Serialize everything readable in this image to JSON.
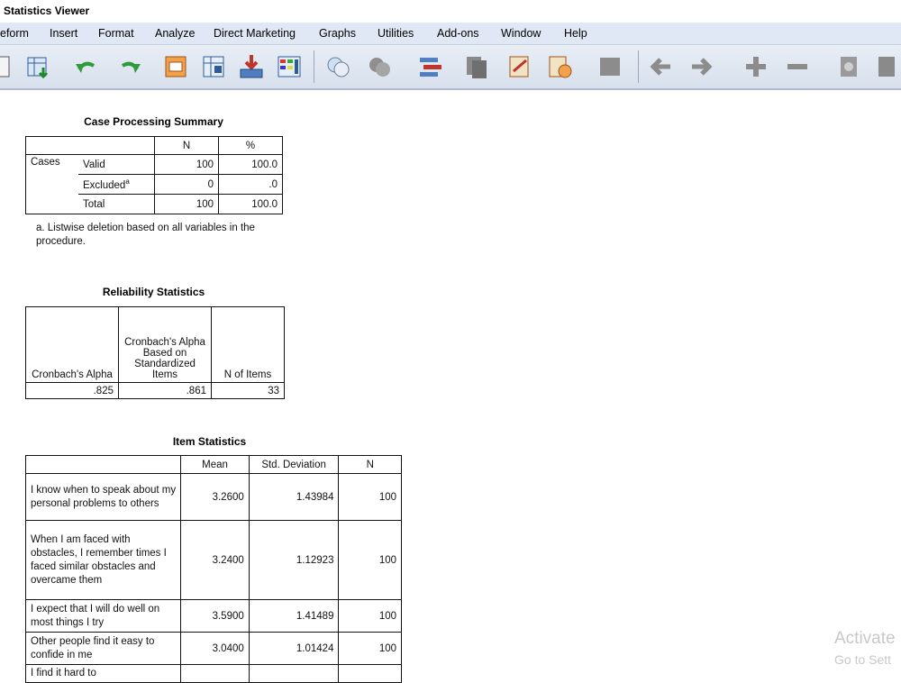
{
  "window": {
    "title": "Statistics Viewer"
  },
  "menu": [
    "eform",
    "Insert",
    "Format",
    "Analyze",
    "Direct Marketing",
    "Graphs",
    "Utilities",
    "Add-ons",
    "Window",
    "Help"
  ],
  "toolbar_icons": [
    "open-icon",
    "import-data-icon",
    "undo-icon",
    "redo-icon",
    "goto-case-icon",
    "goto-variable-icon",
    "export-icon",
    "variables-icon",
    "select-cases-icon",
    "value-labels-icon",
    "use-sets-icon",
    "designate-window-icon",
    "show-all-icon",
    "pivot-icon",
    "insert-output-icon",
    "stop-icon",
    "back-arrow-icon",
    "forward-arrow-icon",
    "expand-icon",
    "collapse-icon",
    "show-icon",
    "hide-icon"
  ],
  "case_processing": {
    "title": "Case Processing Summary",
    "headers": [
      "N",
      "%"
    ],
    "group_label": "Cases",
    "rows": [
      {
        "label": "Valid",
        "n": "100",
        "pct": "100.0"
      },
      {
        "label": "Excluded",
        "sup": "a",
        "n": "0",
        "pct": ".0"
      },
      {
        "label": "Total",
        "n": "100",
        "pct": "100.0"
      }
    ],
    "footnote": "a. Listwise deletion based on all variables in the procedure."
  },
  "reliability": {
    "title": "Reliability Statistics",
    "headers": [
      "Cronbach's Alpha",
      "Cronbach's Alpha Based on Standardized Items",
      "N of Items"
    ],
    "values": [
      ".825",
      ".861",
      "33"
    ]
  },
  "item_stats": {
    "title": "Item Statistics",
    "headers": [
      "Mean",
      "Std. Deviation",
      "N"
    ],
    "rows": [
      {
        "label": "I know when to speak about my personal problems to others",
        "mean": "3.2600",
        "sd": "1.43984",
        "n": "100"
      },
      {
        "label": "When I am faced with obstacles, I remember times I faced similar obstacles and overcame them",
        "mean": "3.2400",
        "sd": "1.12923",
        "n": "100"
      },
      {
        "label": "I expect that I will do well on most things I try",
        "mean": "3.5900",
        "sd": "1.41489",
        "n": "100"
      },
      {
        "label": "Other people find it easy to confide in me",
        "mean": "3.0400",
        "sd": "1.01424",
        "n": "100"
      },
      {
        "label": "I find it hard to",
        "mean": "",
        "sd": "",
        "n": ""
      }
    ]
  },
  "watermark": {
    "line1": "Activate",
    "line2": "Go to Sett"
  }
}
